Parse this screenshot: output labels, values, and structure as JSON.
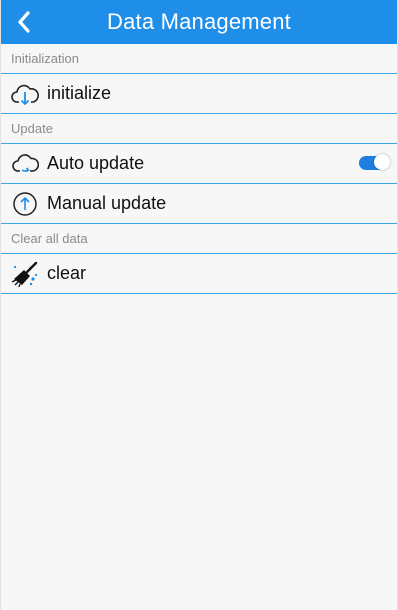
{
  "app": {
    "title": "Data Management",
    "accent_color": "#1f8ee8",
    "divider_color": "#3aa6e6"
  },
  "sections": [
    {
      "header": "Initialization",
      "items": [
        {
          "label": "initialize",
          "icon": "cloud-download-icon"
        }
      ]
    },
    {
      "header": "Update",
      "items": [
        {
          "label": "Auto update",
          "icon": "cloud-sync-icon",
          "toggle": true
        },
        {
          "label": "Manual update",
          "icon": "arrow-up-circle-icon"
        }
      ]
    },
    {
      "header": "Clear all data",
      "items": [
        {
          "label": "clear",
          "icon": "broom-icon"
        }
      ]
    }
  ]
}
